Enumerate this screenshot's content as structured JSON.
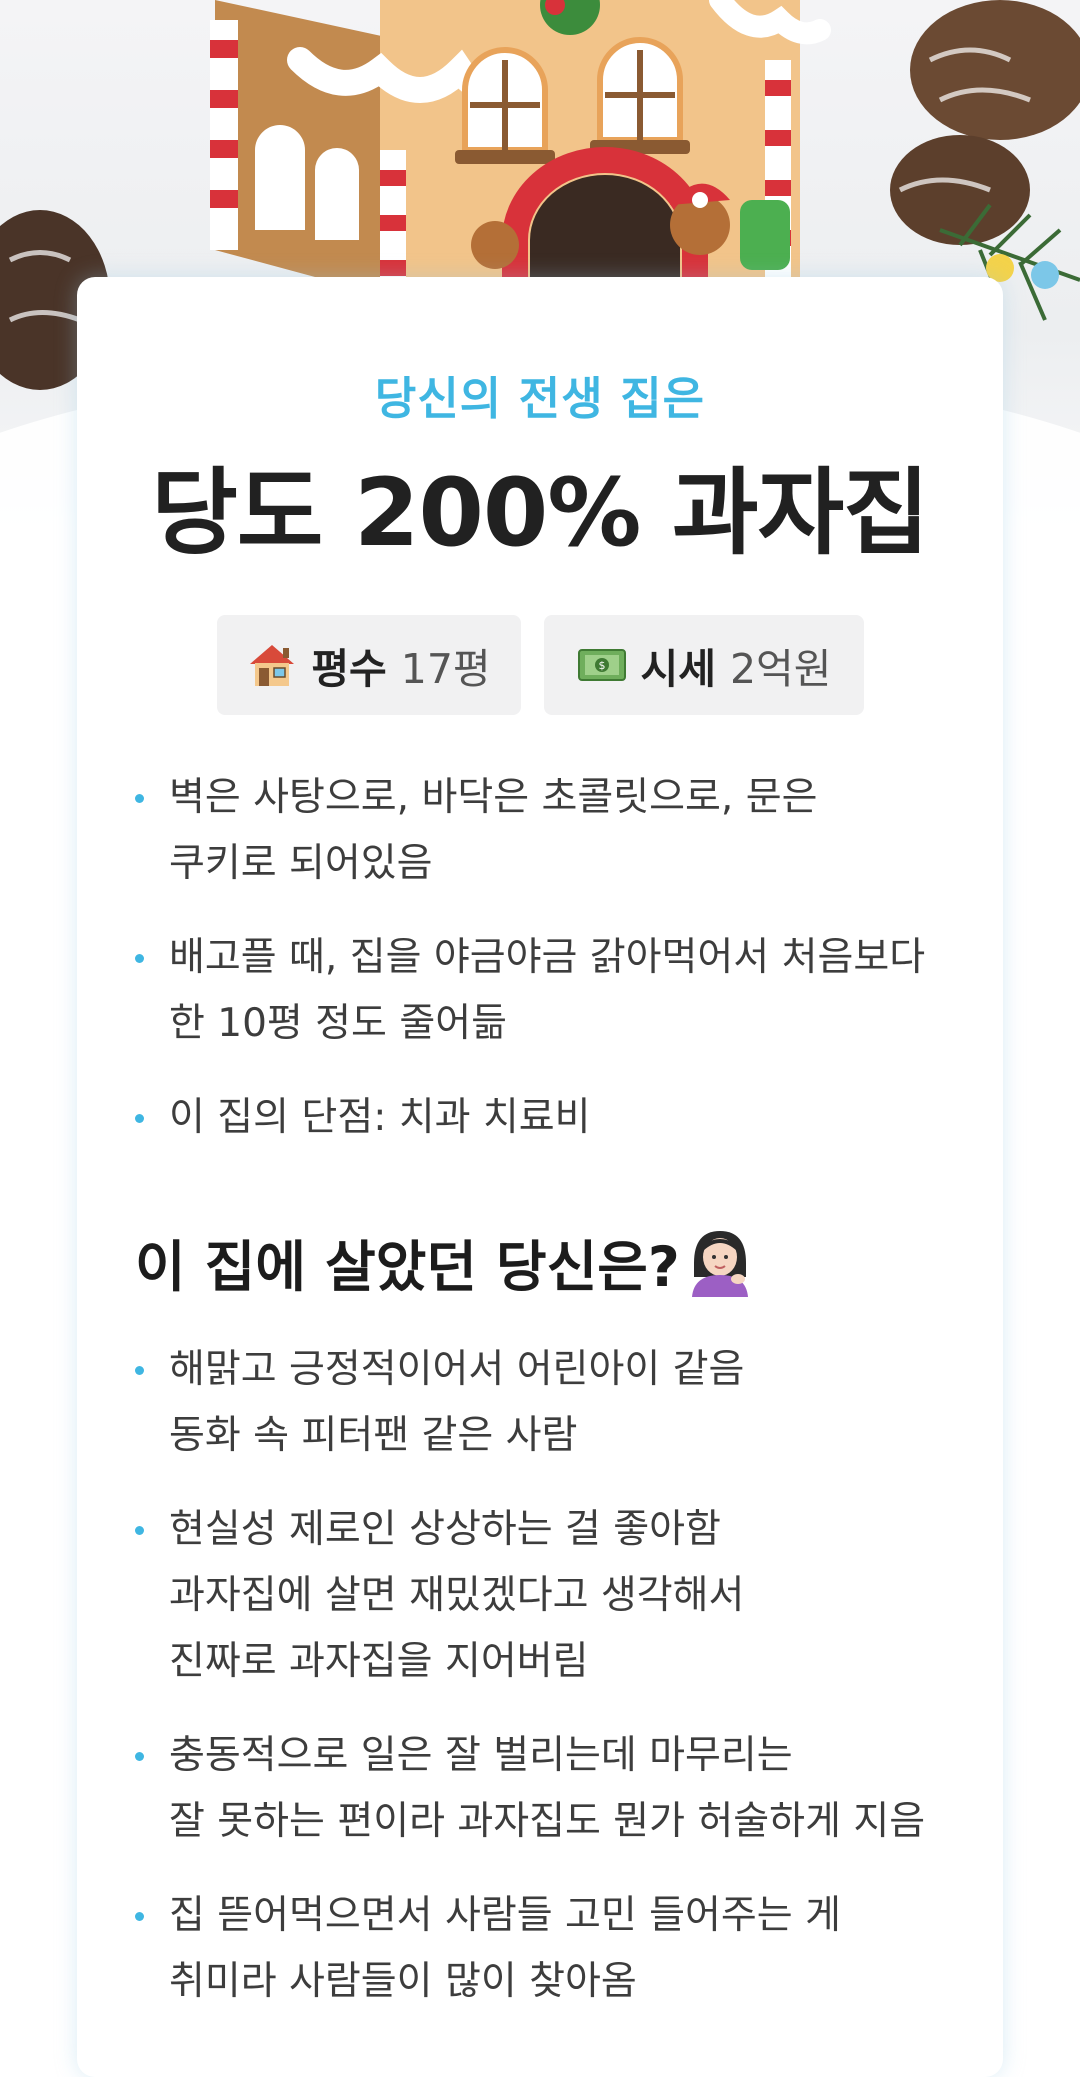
{
  "hero": {
    "icon": "gingerbread-house-illustration"
  },
  "result": {
    "subtitle": "당신의 전생 집은",
    "title": "당도 200% 과자집"
  },
  "stats": [
    {
      "icon": "house-icon",
      "label": "평수",
      "value": "17평"
    },
    {
      "icon": "money-icon",
      "label": "시세",
      "value": "2억원"
    }
  ],
  "description_bullets": [
    {
      "lines": [
        "벽은 사탕으로, 바닥은 초콜릿으로, 문은",
        "쿠키로 되어있음"
      ]
    },
    {
      "lines": [
        "배고플 때, 집을 야금야금 갉아먹어서 처음보다",
        "한 10평 정도 줄어듦"
      ]
    },
    {
      "lines": [
        "이 집의 단점: 치과 치료비"
      ]
    }
  ],
  "personality": {
    "heading": "이 집에 살았던 당신은?",
    "heading_icon": "person-tipping-hand-icon",
    "bullets": [
      {
        "lines": [
          "해맑고 긍정적이어서 어린아이 같음",
          "동화 속 피터팬 같은 사람"
        ]
      },
      {
        "lines": [
          "현실성 제로인 상상하는 걸 좋아함",
          "과자집에 살면 재밌겠다고 생각해서",
          "진짜로 과자집을 지어버림"
        ]
      },
      {
        "lines": [
          "충동적으로 일은 잘 벌리는데 마무리는",
          "잘 못하는 편이라 과자집도 뭔가 허술하게 지음"
        ]
      },
      {
        "lines": [
          "집 뜯어먹으면서 사람들 고민 들어주는 게",
          "취미라 사람들이 많이 찾아옴"
        ]
      }
    ]
  },
  "colors": {
    "accent": "#3fb6e2",
    "title": "#212121",
    "stat_bg": "#f1f1f2"
  }
}
